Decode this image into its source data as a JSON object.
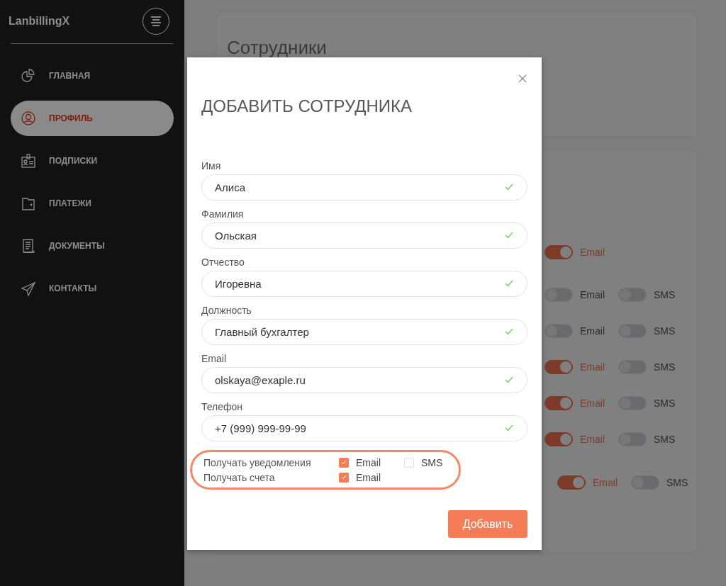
{
  "sidebar": {
    "logo": "LanbillingX",
    "items": [
      {
        "label": "ГЛАВНАЯ",
        "selected": false
      },
      {
        "label": "ПРОФИЛЬ",
        "selected": true
      },
      {
        "label": "ПОДПИСКИ",
        "selected": false
      },
      {
        "label": "ПЛАТЕЖИ",
        "selected": false
      },
      {
        "label": "ДОКУМЕНТЫ",
        "selected": false
      },
      {
        "label": "КОНТАКТЫ",
        "selected": false
      }
    ]
  },
  "background": {
    "title": "Сотрудники",
    "toggle_rows": [
      {
        "toggles": [
          {
            "label": "Email",
            "on": true
          }
        ]
      },
      {
        "toggles": [
          {
            "label": "Email",
            "on": false
          },
          {
            "label": "SMS",
            "on": false
          }
        ]
      },
      {
        "toggles": [
          {
            "label": "Email",
            "on": false
          },
          {
            "label": "SMS",
            "on": false
          }
        ]
      },
      {
        "toggles": [
          {
            "label": "Email",
            "on": true
          },
          {
            "label": "SMS",
            "on": false
          }
        ]
      },
      {
        "toggles": [
          {
            "label": "Email",
            "on": true
          },
          {
            "label": "SMS",
            "on": false
          }
        ]
      },
      {
        "toggles": [
          {
            "label": "Email",
            "on": true
          },
          {
            "label": "SMS",
            "on": false
          }
        ]
      },
      {
        "toggles": [
          {
            "label": "Email",
            "on": true
          },
          {
            "label": "SMS",
            "on": false
          }
        ]
      }
    ]
  },
  "modal": {
    "title": "ДОБАВИТЬ СОТРУДНИКА",
    "fields": [
      {
        "label": "Имя",
        "value": "Алиса",
        "valid": true
      },
      {
        "label": "Фамилия",
        "value": "Ольская",
        "valid": true
      },
      {
        "label": "Отчество",
        "value": "Игоревна",
        "valid": true
      },
      {
        "label": "Должность",
        "value": "Главный бухгалтер",
        "valid": true
      },
      {
        "label": "Email",
        "value": "olskaya@exaple.ru",
        "valid": true
      },
      {
        "label": "Телефон",
        "value": "+7 (999) 999-99-99",
        "valid": true
      }
    ],
    "options_highlighted": true,
    "options": [
      {
        "label": "Получать уведомления",
        "checks": [
          {
            "label": "Email",
            "checked": true
          },
          {
            "label": "SMS",
            "checked": false
          }
        ]
      },
      {
        "label": "Получать счета",
        "checks": [
          {
            "label": "Email",
            "checked": true
          }
        ]
      }
    ],
    "submit": "Добавить"
  }
}
